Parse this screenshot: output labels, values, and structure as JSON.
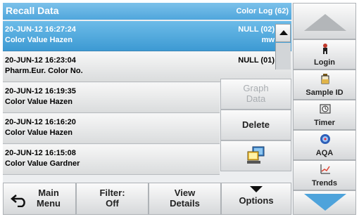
{
  "header": {
    "title": "Recall Data",
    "log_count": "Color Log (62)"
  },
  "records": [
    {
      "date": "20-JUN-12  16:27:24",
      "name": "Color Value Hazen",
      "value": "NULL (02)",
      "unit": "mw",
      "selected": true
    },
    {
      "date": "20-JUN-12  16:23:04",
      "name": "Pharm.Eur. Color No.",
      "value": "NULL (01)",
      "unit": ""
    },
    {
      "date": "20-JUN-12  16:19:35",
      "name": "Color Value Hazen",
      "value": "",
      "unit": ""
    },
    {
      "date": "20-JUN-12  16:16:20",
      "name": "Color Value Hazen",
      "value": "",
      "unit": ""
    },
    {
      "date": "20-JUN-12  16:15:08",
      "name": "Color Value Gardner",
      "value": "",
      "unit": ""
    }
  ],
  "popup": {
    "graph_data_line1": "Graph",
    "graph_data_line2": "Data",
    "delete_label": "Delete",
    "computer_icon": "computer-icon"
  },
  "bottom": {
    "main_menu_line1": "Main",
    "main_menu_line2": "Menu",
    "filter_line1": "Filter:",
    "filter_line2": "Off",
    "view_details_line1": "View",
    "view_details_line2": "Details",
    "options_label": "Options"
  },
  "sidebar": {
    "login": "Login",
    "sample_id": "Sample ID",
    "timer": "Timer",
    "aqa": "AQA",
    "trends": "Trends"
  },
  "colors": {
    "accent": "#4fa6dc",
    "scroll_arrow": "#4ea3db"
  }
}
